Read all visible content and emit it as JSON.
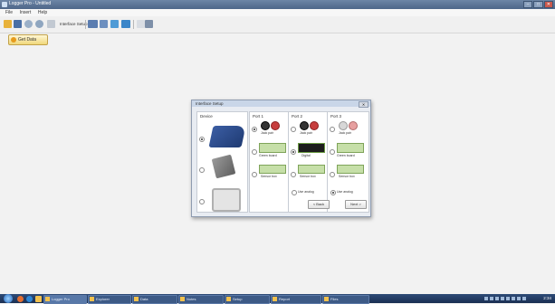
{
  "window": {
    "title": "Logger Pro - Untitled",
    "controls": [
      "–",
      "□",
      "✕"
    ]
  },
  "menu": {
    "items": [
      "File",
      "Insert",
      "Help"
    ]
  },
  "toolbar": {
    "label": "Interface Setup"
  },
  "start_button": {
    "label": "Get Data"
  },
  "dialog": {
    "title": "Interface Setup",
    "close_label": "✕",
    "columns": {
      "device": {
        "label": "Device"
      },
      "port1": {
        "label": "Port 1"
      },
      "port2": {
        "label": "Port 2"
      },
      "port3": {
        "label": "Port 3"
      }
    },
    "captions": {
      "jack_pair": "Jack pair",
      "green_board": "Green board",
      "digital": "Digital",
      "sensor_box": "Sensor box"
    },
    "options": {
      "port2": "Use analog",
      "port3": "Use analog"
    },
    "buttons": {
      "back": "< Back",
      "next": "Next >"
    }
  },
  "taskbar": {
    "tasks": [
      "Logger Pro",
      "Explorer",
      "Data",
      "Notes",
      "Setup",
      "Report",
      "Files"
    ],
    "clock": "2:34"
  },
  "colors": {
    "titlebar": "#4d6689",
    "taskbar": "#1a2f52",
    "accent_green": "#c6dfa8",
    "jack_red": "#c73d3d"
  }
}
